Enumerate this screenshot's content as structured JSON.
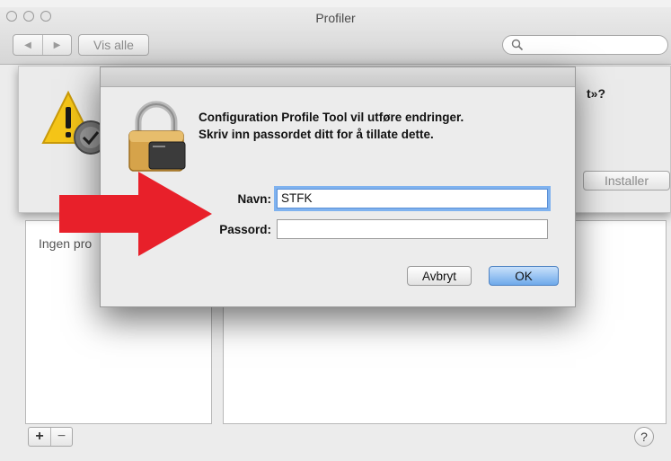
{
  "window": {
    "title": "Profiler",
    "show_all_label": "Vis alle",
    "nav_back_icon": "back-arrow-icon",
    "nav_forward_icon": "forward-arrow-icon",
    "search_placeholder": ""
  },
  "profile_sheet": {
    "question_tail": "t»?",
    "install_label": "Installer"
  },
  "left_pane": {
    "empty_text": "Ingen pro"
  },
  "bottom": {
    "add_label": "+",
    "remove_label": "−",
    "help_label": "?"
  },
  "auth_dialog": {
    "message_line1": "Configuration Profile Tool vil utføre endringer.",
    "message_line2": "Skriv inn passordet ditt for å tillate dette.",
    "name_label": "Navn:",
    "name_value": "STFK",
    "password_label": "Passord:",
    "password_value": "",
    "cancel_label": "Avbryt",
    "ok_label": "OK"
  },
  "colors": {
    "arrow": "#e8202a",
    "default_button": "#6ea9ea",
    "focus_ring": "#7fb2ef"
  }
}
